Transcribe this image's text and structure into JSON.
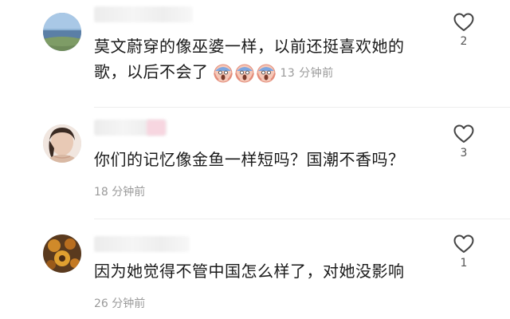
{
  "comments": [
    {
      "text_lines": [
        "莫文蔚穿的像巫婆一样，以前还挺喜欢她的",
        "歌，以后不会了"
      ],
      "emojis": [
        "scream-face-icon",
        "scream-face-icon",
        "scream-face-icon"
      ],
      "time": "13 分钟前",
      "likes": "2"
    },
    {
      "text_lines": [
        "你们的记忆像金鱼一样短吗？国潮不香吗？"
      ],
      "time": "18 分钟前",
      "likes": "3"
    },
    {
      "text_lines": [
        "因为她觉得不管中国怎么样了，对她没影响"
      ],
      "time": "26 分钟前",
      "likes": "1"
    }
  ]
}
